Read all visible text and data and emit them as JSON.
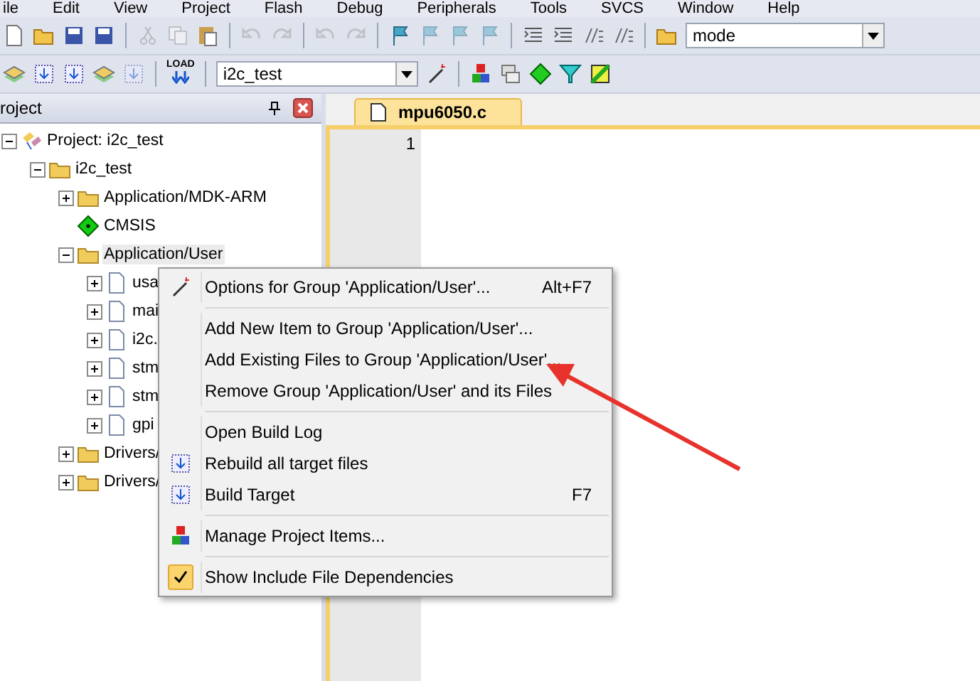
{
  "menu_bar": [
    "ile",
    "Edit",
    "View",
    "Project",
    "Flash",
    "Debug",
    "Peripherals",
    "Tools",
    "SVCS",
    "Window",
    "Help"
  ],
  "toolbar_1": {
    "buttons": [
      {
        "kind": "new",
        "disabled": false
      },
      {
        "kind": "open",
        "disabled": false
      },
      {
        "kind": "save",
        "disabled": false
      },
      {
        "kind": "saveall",
        "disabled": false
      },
      {
        "kind": "sep"
      },
      {
        "kind": "cut",
        "disabled": true
      },
      {
        "kind": "copy",
        "disabled": true
      },
      {
        "kind": "paste",
        "disabled": false
      },
      {
        "kind": "sep"
      },
      {
        "kind": "undo",
        "disabled": true
      },
      {
        "kind": "redo",
        "disabled": true
      },
      {
        "kind": "sep"
      },
      {
        "kind": "back",
        "disabled": true
      },
      {
        "kind": "fwd",
        "disabled": true
      },
      {
        "kind": "sep"
      },
      {
        "kind": "flag",
        "disabled": false
      },
      {
        "kind": "flag",
        "disabled": true
      },
      {
        "kind": "flag",
        "disabled": true
      },
      {
        "kind": "flag",
        "disabled": true
      },
      {
        "kind": "sep"
      },
      {
        "kind": "indent",
        "disabled": false
      },
      {
        "kind": "indent",
        "disabled": false
      },
      {
        "kind": "comment",
        "disabled": false
      },
      {
        "kind": "comment",
        "disabled": false
      },
      {
        "kind": "sep"
      },
      {
        "kind": "find",
        "disabled": false
      }
    ],
    "combo": "mode"
  },
  "toolbar_2": {
    "buttons": [
      {
        "kind": "stack",
        "disabled": false
      },
      {
        "kind": "build",
        "disabled": false
      },
      {
        "kind": "build",
        "disabled": false
      },
      {
        "kind": "layers",
        "disabled": false
      },
      {
        "kind": "build",
        "disabled": true
      },
      {
        "kind": "sep"
      },
      {
        "kind": "load",
        "disabled": false,
        "label": "LOAD"
      },
      {
        "kind": "sep"
      }
    ],
    "combo": "i2c_test",
    "after": [
      {
        "kind": "wand",
        "disabled": false
      },
      {
        "kind": "sep"
      },
      {
        "kind": "manage",
        "disabled": false
      },
      {
        "kind": "windows",
        "disabled": false
      },
      {
        "kind": "component",
        "disabled": false
      },
      {
        "kind": "funnel",
        "disabled": false
      },
      {
        "kind": "pack",
        "disabled": false
      }
    ]
  },
  "project_panel": {
    "title": "roject",
    "tree": [
      {
        "kind": "project",
        "label": "Project: i2c_test",
        "expanded": true,
        "selected": false,
        "children": [
          {
            "kind": "target",
            "label": "i2c_test",
            "expanded": true,
            "selected": false,
            "children": [
              {
                "kind": "folder",
                "label": "Application/MDK-ARM",
                "expanded": false,
                "selected": false
              },
              {
                "kind": "component",
                "label": "CMSIS",
                "selected": false
              },
              {
                "kind": "folder",
                "label": "Application/User",
                "expanded": true,
                "selected": true,
                "children": [
                  {
                    "kind": "file",
                    "label": "usa",
                    "expanded": false,
                    "selected": false
                  },
                  {
                    "kind": "file",
                    "label": "mai",
                    "expanded": false,
                    "selected": false
                  },
                  {
                    "kind": "file",
                    "label": "i2c.",
                    "expanded": false,
                    "selected": false
                  },
                  {
                    "kind": "file",
                    "label": "stm",
                    "expanded": false,
                    "selected": false
                  },
                  {
                    "kind": "file",
                    "label": "stm",
                    "expanded": false,
                    "selected": false
                  },
                  {
                    "kind": "file",
                    "label": "gpi",
                    "expanded": false,
                    "selected": false
                  }
                ]
              },
              {
                "kind": "folder",
                "label": "Drivers/",
                "expanded": false,
                "selected": false
              },
              {
                "kind": "folder",
                "label": "Drivers/",
                "expanded": false,
                "selected": false
              }
            ]
          }
        ]
      }
    ]
  },
  "editor": {
    "tabs": [
      {
        "label": "mpu6050.c",
        "selected": true
      }
    ],
    "line_numbers": [
      "1"
    ]
  },
  "context_menu": {
    "sections": [
      [
        {
          "kind": "options",
          "label": "Options for Group 'Application/User'...",
          "shortcut": "Alt+F7"
        }
      ],
      [
        {
          "kind": "plain",
          "label": "Add New  Item to Group 'Application/User'..."
        },
        {
          "kind": "plain",
          "label": "Add Existing Files to Group 'Application/User'..."
        },
        {
          "kind": "plain",
          "label": "Remove Group 'Application/User' and its Files"
        }
      ],
      [
        {
          "kind": "plain",
          "label": "Open Build Log"
        },
        {
          "kind": "rebuild",
          "label": "Rebuild all target files"
        },
        {
          "kind": "build",
          "label": "Build Target",
          "shortcut": "F7"
        }
      ],
      [
        {
          "kind": "manage",
          "label": "Manage Project Items..."
        }
      ],
      [
        {
          "kind": "toggle",
          "label": "Show Include File Dependencies",
          "checked": true
        }
      ]
    ]
  },
  "annotation": {
    "kind": "arrow"
  }
}
